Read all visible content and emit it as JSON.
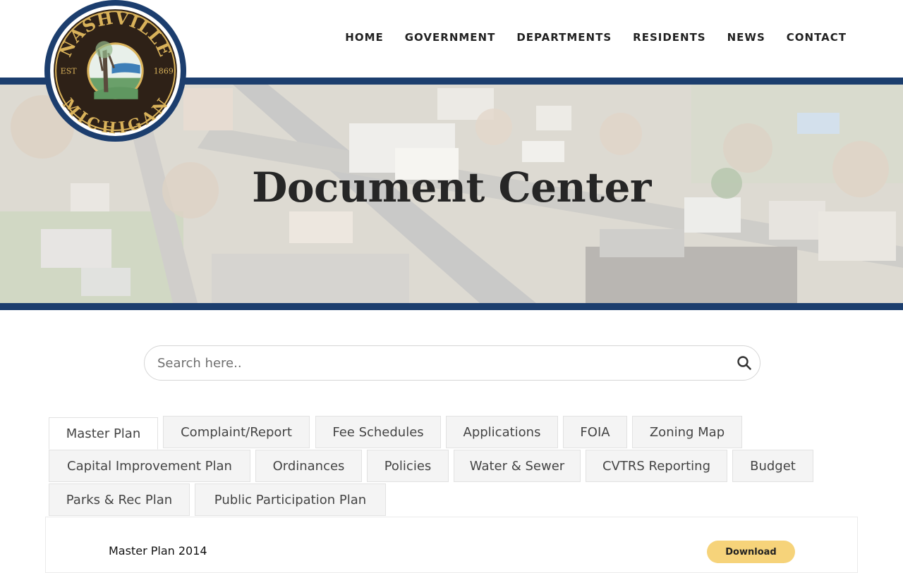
{
  "logo": {
    "top_text": "NASHVILLE",
    "bottom_text": "MICHIGAN",
    "est_label": "EST",
    "est_year": "1869"
  },
  "nav": {
    "items": [
      "HOME",
      "GOVERNMENT",
      "DEPARTMENTS",
      "RESIDENTS",
      "NEWS",
      "CONTACT"
    ]
  },
  "hero": {
    "title": "Document Center"
  },
  "search": {
    "placeholder": "Search here.."
  },
  "tabs": [
    "Master Plan",
    "Complaint/Report",
    "Fee Schedules",
    "Applications",
    "FOIA",
    "Zoning Map",
    "Capital Improvement Plan",
    "Ordinances",
    "Policies",
    "Water & Sewer",
    "CVTRS Reporting",
    "Budget",
    "Parks & Rec Plan",
    "Public Participation Plan"
  ],
  "active_tab": "Master Plan",
  "documents": [
    {
      "title": "Master Plan 2014",
      "action": "Download"
    }
  ],
  "colors": {
    "brand_navy": "#1c3e6e",
    "seal_gold": "#d9b25a",
    "download_button": "#f6d37a"
  }
}
